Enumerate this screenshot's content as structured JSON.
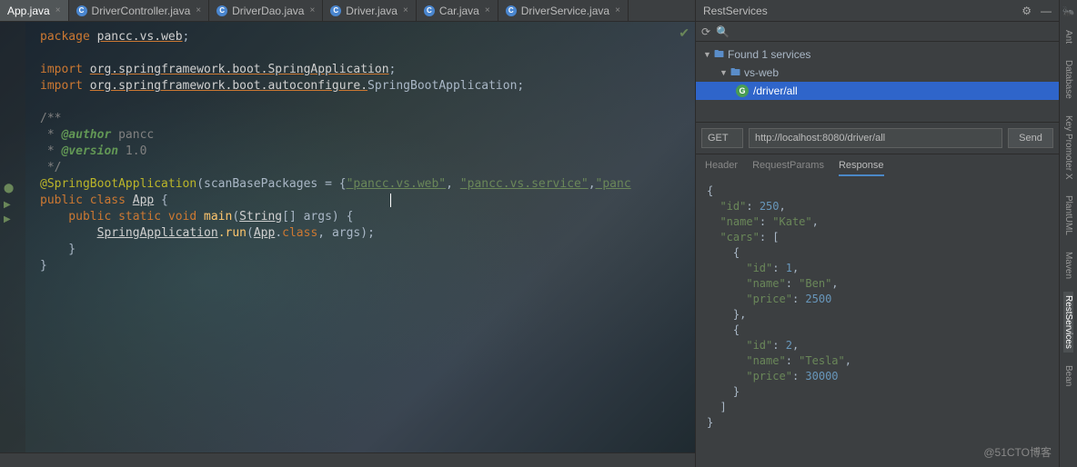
{
  "tabs": [
    {
      "label": "App.java"
    },
    {
      "label": "DriverController.java"
    },
    {
      "label": "DriverDao.java"
    },
    {
      "label": "Driver.java"
    },
    {
      "label": "Car.java"
    },
    {
      "label": "DriverService.java"
    }
  ],
  "code": {
    "package_kw": "package",
    "package_val": "pancc.vs.web",
    "import_kw": "import",
    "import1": "org.springframework.boot.SpringApplication",
    "import2_pre": "org.springframework.boot.autoconfigure.",
    "import2_cls": "SpringBootApplication",
    "doc_open": "/**",
    "doc_author": " * @author pancc",
    "doc_version": " * @version 1.0",
    "doc_close": " */",
    "anno": "@SpringBootApplication",
    "anno_args_a": "(scanBasePackages = {",
    "anno_str1": "\"pancc.vs.web\"",
    "anno_str2": "\"pancc.vs.service\"",
    "anno_str3": "\"panc",
    "class_line_a": "public class ",
    "class_name": "App",
    "class_line_b": " {",
    "main_sig_a": "    public static void ",
    "main_fn": "main",
    "main_sig_b": "(",
    "main_type": "String",
    "main_sig_c": "[] args) {",
    "run_a": "        ",
    "run_cls": "SpringApplication",
    "run_b": ".run(",
    "run_arg": "App",
    "run_c": ".class, args);",
    "brace_close_inner": "    }",
    "brace_close_outer": "}"
  },
  "rest": {
    "title": "RestServices",
    "found": "Found 1 services",
    "project": "vs-web",
    "endpoint": "/driver/all",
    "method": "GET",
    "url": "http://localhost:8080/driver/all",
    "send": "Send",
    "tabs": {
      "header": "Header",
      "params": "RequestParams",
      "response": "Response"
    },
    "response_text": "{\n  \"id\": 250,\n  \"name\": \"Kate\",\n  \"cars\": [\n    {\n      \"id\": 1,\n      \"name\": \"Ben\",\n      \"price\": 2500\n    },\n    {\n      \"id\": 2,\n      \"name\": \"Tesla\",\n      \"price\": 30000\n    }\n  ]\n}",
    "response_lines": [
      {
        "indent": 0,
        "text": "{"
      },
      {
        "indent": 2,
        "key": "id",
        "num": "250",
        "comma": ","
      },
      {
        "indent": 2,
        "key": "name",
        "str": "Kate",
        "comma": ","
      },
      {
        "indent": 2,
        "key": "cars",
        "raw": "["
      },
      {
        "indent": 4,
        "text": "{"
      },
      {
        "indent": 6,
        "key": "id",
        "num": "1",
        "comma": ","
      },
      {
        "indent": 6,
        "key": "name",
        "str": "Ben",
        "comma": ","
      },
      {
        "indent": 6,
        "key": "price",
        "num": "2500"
      },
      {
        "indent": 4,
        "text": "},"
      },
      {
        "indent": 4,
        "text": "{"
      },
      {
        "indent": 6,
        "key": "id",
        "num": "2",
        "comma": ","
      },
      {
        "indent": 6,
        "key": "name",
        "str": "Tesla",
        "comma": ","
      },
      {
        "indent": 6,
        "key": "price",
        "num": "30000"
      },
      {
        "indent": 4,
        "text": "}"
      },
      {
        "indent": 2,
        "text": "]"
      },
      {
        "indent": 0,
        "text": "}"
      }
    ]
  },
  "rail": [
    "Ant",
    "Database",
    "Key Promoter X",
    "PlantUML",
    "Maven",
    "RestServices",
    "Bean"
  ],
  "watermark": "@51CTO博客"
}
